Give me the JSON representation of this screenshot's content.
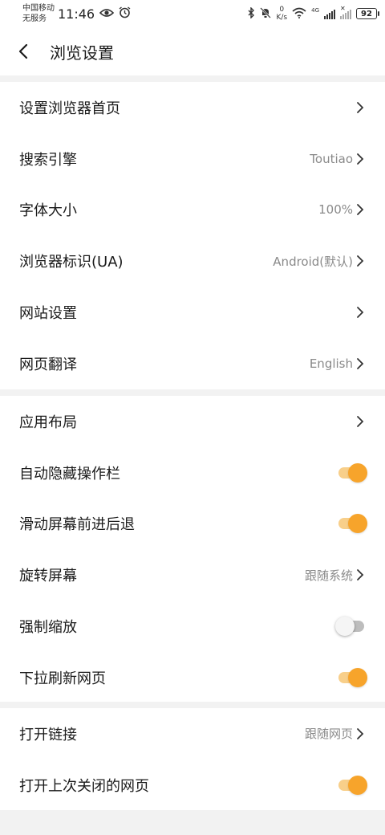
{
  "status_bar": {
    "carrier_line1": "中国移动",
    "carrier_line2": "无服务",
    "time": "11:46",
    "net_speed_value": "0",
    "net_speed_unit": "K/s",
    "network_type": "4G",
    "battery": "92"
  },
  "header": {
    "title": "浏览设置"
  },
  "sections": [
    {
      "rows": [
        {
          "label": "设置浏览器首页",
          "value": "",
          "control": "chevron"
        },
        {
          "label": "搜索引擎",
          "value": "Toutiao",
          "control": "chevron"
        },
        {
          "label": "字体大小",
          "value": "100%",
          "control": "chevron"
        },
        {
          "label": "浏览器标识(UA)",
          "value": "Android(默认)",
          "control": "chevron"
        },
        {
          "label": "网站设置",
          "value": "",
          "control": "chevron"
        },
        {
          "label": "网页翻译",
          "value": "English",
          "control": "chevron"
        }
      ]
    },
    {
      "rows": [
        {
          "label": "应用布局",
          "value": "",
          "control": "chevron"
        },
        {
          "label": "自动隐藏操作栏",
          "control": "toggle",
          "on": true
        },
        {
          "label": "滑动屏幕前进后退",
          "control": "toggle",
          "on": true
        },
        {
          "label": "旋转屏幕",
          "value": "跟随系统",
          "control": "chevron"
        },
        {
          "label": "强制缩放",
          "control": "toggle",
          "on": false
        },
        {
          "label": "下拉刷新网页",
          "control": "toggle",
          "on": true
        }
      ]
    },
    {
      "rows": [
        {
          "label": "打开链接",
          "value": "跟随网页",
          "control": "chevron"
        },
        {
          "label": "打开上次关闭的网页",
          "control": "toggle",
          "on": true
        }
      ]
    }
  ],
  "colors": {
    "accent": "#f7a42b",
    "accent_track": "#f8cf8a",
    "background": "#f2f2f2",
    "secondary_text": "#8a8a8a"
  }
}
